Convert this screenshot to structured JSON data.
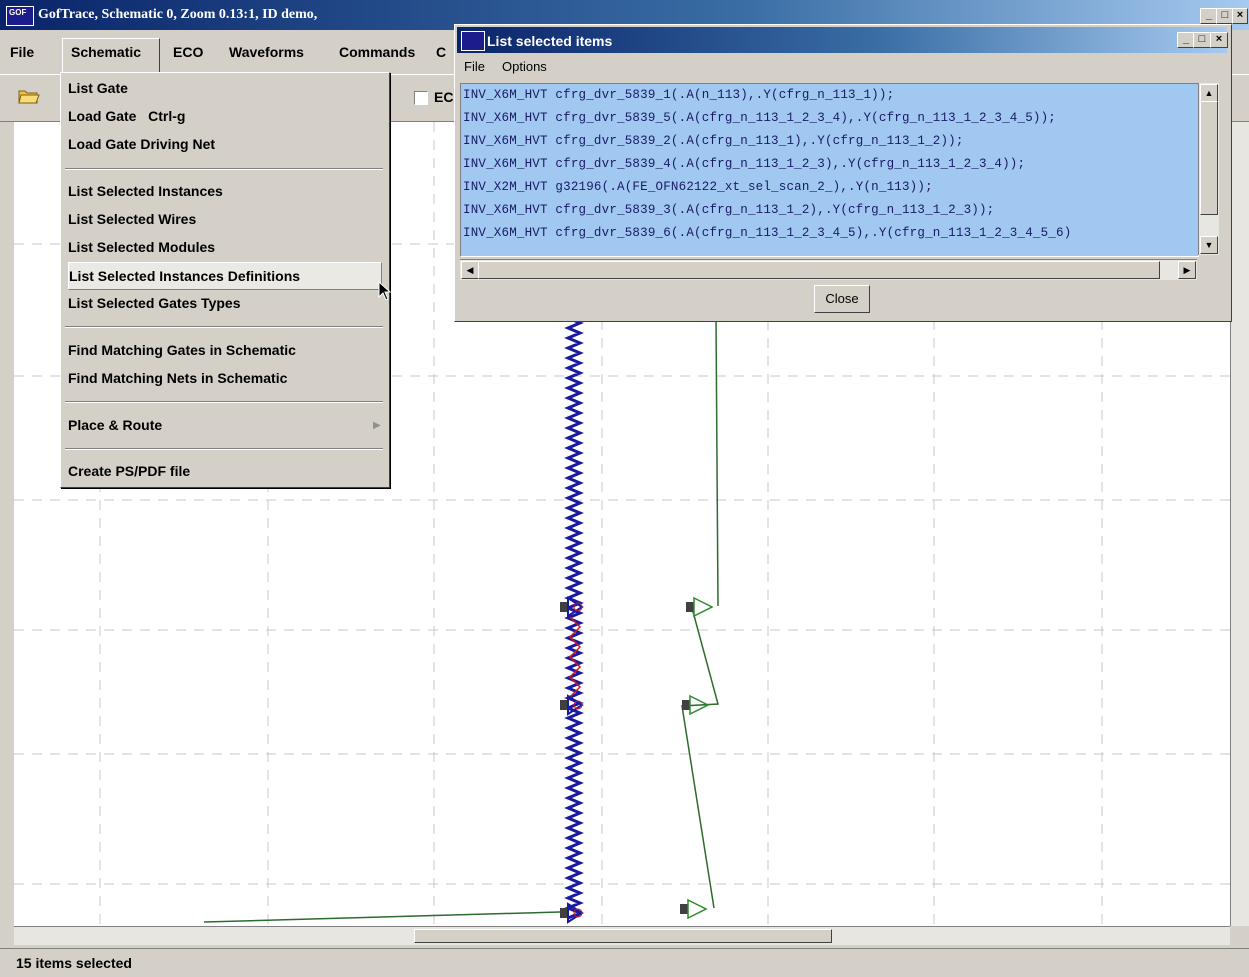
{
  "window": {
    "title": "GofTrace, Schematic 0, Zoom 0.13:1, ID demo,"
  },
  "menubar": {
    "items": [
      "File",
      "Schematic",
      "ECO",
      "Waveforms",
      "Commands",
      "C"
    ]
  },
  "toolbar": {
    "eco_checkbox_label": "EC"
  },
  "schematic_menu": {
    "groups": [
      [
        "List Gate",
        "Load Gate   Ctrl-g",
        "Load Gate Driving Net"
      ],
      [
        "List Selected Instances",
        "List Selected Wires",
        "List Selected Modules",
        "List Selected Instances Definitions",
        "List Selected Gates Types"
      ],
      [
        "Find Matching Gates in Schematic",
        "Find Matching Nets in Schematic"
      ],
      [
        "Place & Route"
      ],
      [
        "Create PS/PDF file"
      ]
    ],
    "highlighted": "List Selected Instances Definitions"
  },
  "popup": {
    "title": "List selected items",
    "menu": [
      "File",
      "Options"
    ],
    "lines": [
      "INV_X6M_HVT cfrg_dvr_5839_1(.A(n_113),.Y(cfrg_n_113_1));",
      "INV_X6M_HVT cfrg_dvr_5839_5(.A(cfrg_n_113_1_2_3_4),.Y(cfrg_n_113_1_2_3_4_5));",
      "INV_X6M_HVT cfrg_dvr_5839_2(.A(cfrg_n_113_1),.Y(cfrg_n_113_1_2));",
      "INV_X6M_HVT cfrg_dvr_5839_4(.A(cfrg_n_113_1_2_3),.Y(cfrg_n_113_1_2_3_4));",
      "INV_X2M_HVT g32196(.A(FE_OFN62122_xt_sel_scan_2_),.Y(n_113));",
      "INV_X6M_HVT cfrg_dvr_5839_3(.A(cfrg_n_113_1_2),.Y(cfrg_n_113_1_2_3));",
      "INV_X6M_HVT cfrg_dvr_5839_6(.A(cfrg_n_113_1_2_3_4_5),.Y(cfrg_n_113_1_2_3_4_5_6)"
    ],
    "close_label": "Close"
  },
  "status": {
    "text": "15 items selected"
  },
  "colors": {
    "titlebar": "#0a246a",
    "list_bg": "#a0c8f0",
    "wire_green": "#2e6b2e",
    "wire_blue": "#1a1aa0",
    "wire_red": "#d01818"
  }
}
